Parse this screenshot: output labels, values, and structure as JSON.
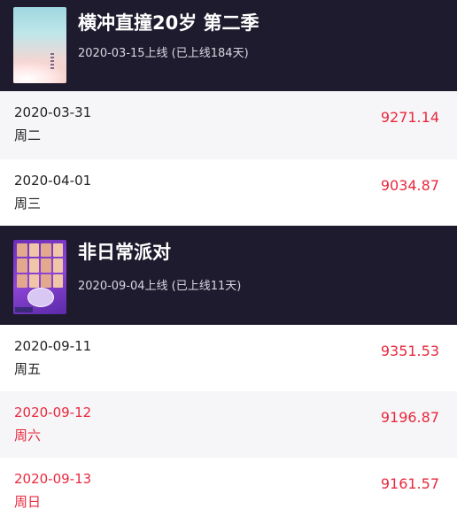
{
  "shows": [
    {
      "title": "横冲直撞20岁 第二季",
      "subtitle": "2020-03-15上线 (已上线184天)",
      "poster_icon": "poster-hengchongzhizhuang",
      "rows": [
        {
          "date": "2020-03-31",
          "day": "周二",
          "value": "9271.14",
          "highlight": false
        },
        {
          "date": "2020-04-01",
          "day": "周三",
          "value": "9034.87",
          "highlight": false
        }
      ]
    },
    {
      "title": "非日常派对",
      "subtitle": "2020-09-04上线 (已上线11天)",
      "poster_icon": "poster-feirichang-paidui",
      "rows": [
        {
          "date": "2020-09-11",
          "day": "周五",
          "value": "9351.53",
          "highlight": false
        },
        {
          "date": "2020-09-12",
          "day": "周六",
          "value": "9196.87",
          "highlight": true
        },
        {
          "date": "2020-09-13",
          "day": "周日",
          "value": "9161.57",
          "highlight": true
        }
      ]
    }
  ],
  "colors": {
    "header_bg": "#1f1b2e",
    "accent_red": "#e8283d",
    "row_shaded": "#f6f6f8"
  }
}
